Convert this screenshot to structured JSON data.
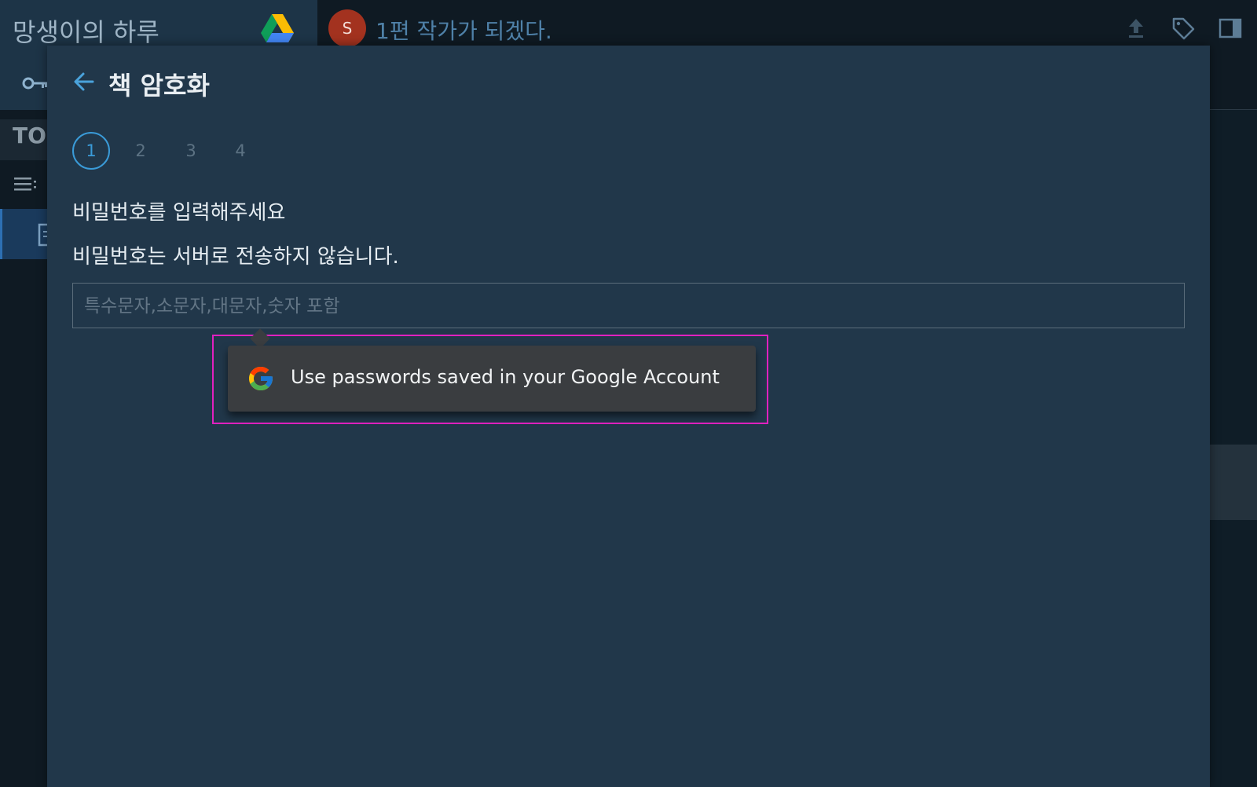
{
  "sidebar": {
    "book_title": "망생이의 하루",
    "toc_label": "TOC"
  },
  "topbar": {
    "avatar_letter": "S",
    "chapter_title": "1편 작가가 되겠다."
  },
  "modal": {
    "title": "책 암호화",
    "steps": [
      "1",
      "2",
      "3",
      "4"
    ],
    "active_step": "1",
    "prompt_line1": "비밀번호를 입력해주세요",
    "prompt_line2": "비밀번호는 서버로 전송하지 않습니다.",
    "password": {
      "value": "",
      "placeholder": "특수문자,소문자,대문자,숫자 포함"
    }
  },
  "autofill": {
    "label": "Use passwords saved in your Google Account",
    "icon": "google-icon"
  },
  "colors": {
    "modal_bg": "#21374a",
    "accent": "#3a9bd8",
    "highlight": "#e021c0",
    "popup_bg": "#3a3d40",
    "avatar_bg": "#a3321f"
  }
}
